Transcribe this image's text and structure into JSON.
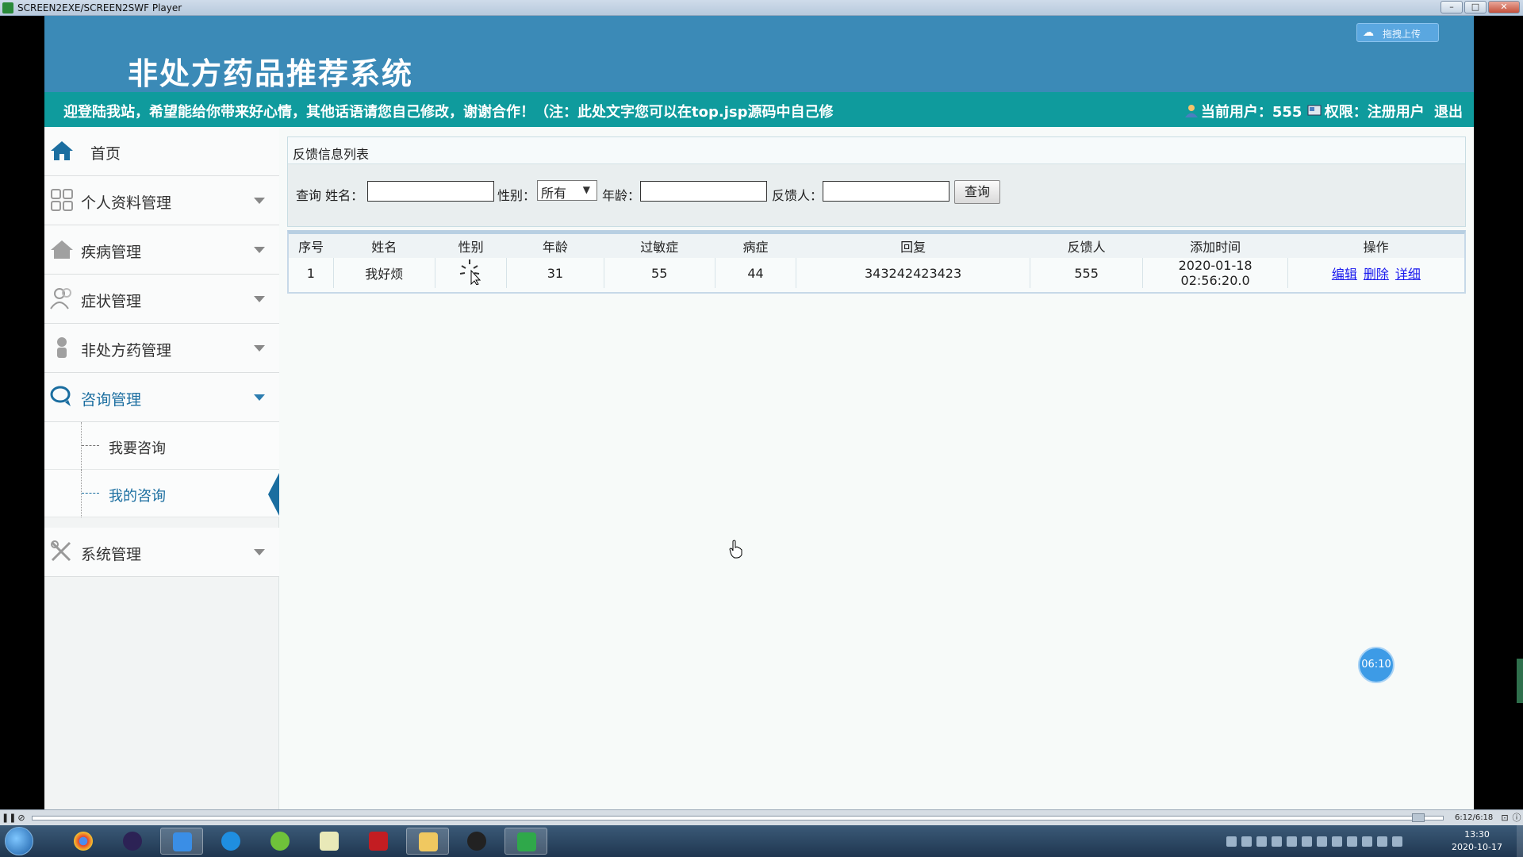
{
  "window": {
    "title": "SCREEN2EXE/SCREEN2SWF Player",
    "buttons": [
      "–",
      "□",
      "✕"
    ]
  },
  "header": {
    "system_title": "非处方药品推荐系统",
    "upload_label": "拖拽上传",
    "upload_icon": "baidu-cloud-icon"
  },
  "notice": {
    "marquee": "迎登陆我站，希望能给你带来好心情，其他话语请您自己修改，谢谢合作！（注：此处文字您可以在top.jsp源码中自己修",
    "current_user_label": "当前用户：",
    "current_user": "555",
    "role_label": "权限：",
    "role": "注册用户",
    "logout": "退出"
  },
  "sidebar": {
    "home": "首页",
    "items": [
      {
        "label": "个人资料管理",
        "icon": "grid-icon"
      },
      {
        "label": "疾病管理",
        "icon": "house-icon"
      },
      {
        "label": "症状管理",
        "icon": "users-icon"
      },
      {
        "label": "非处方药管理",
        "icon": "person-icon"
      },
      {
        "label": "咨询管理",
        "icon": "chat-icon",
        "active": true
      },
      {
        "label": "系统管理",
        "icon": "tools-icon"
      }
    ],
    "submenu": [
      {
        "label": "我要咨询"
      },
      {
        "label": "我的咨询",
        "current": true
      }
    ]
  },
  "panel": {
    "title": "反馈信息列表",
    "query_label": "查询 姓名：",
    "gender_label": "性别：",
    "gender_selected": "所有",
    "age_label": "年龄：",
    "feedback_person_label": "反馈人：",
    "query_button": "查询",
    "name_value": "",
    "age_value": "",
    "person_value": ""
  },
  "table": {
    "columns": [
      "序号",
      "姓名",
      "性别",
      "年龄",
      "过敏症",
      "病症",
      "回复",
      "反馈人",
      "添加时间",
      "操作"
    ],
    "rows": [
      {
        "index": "1",
        "name": "我好烦",
        "gender": "",
        "age": "31",
        "allergy": "55",
        "disease": "44",
        "reply": "343242423423",
        "person": "555",
        "time": "2020-01-18 02:56:20.0",
        "ops": [
          "编辑",
          "删除",
          "详细"
        ]
      }
    ]
  },
  "overlay": {
    "timer": "06:10"
  },
  "player": {
    "time": "6:12/6:18"
  },
  "taskbar": {
    "apps": [
      "chrome-icon",
      "eclipse-icon",
      "baidu-cloud-icon",
      "qq-browser-icon",
      "360-icon",
      "notepad-icon",
      "flash-icon",
      "explorer-icon",
      "qq-icon",
      "screen2exe-icon"
    ],
    "clock_time": "13:30",
    "clock_date": "2020-10-17"
  },
  "colors": {
    "header_blue": "#3b8ab7",
    "notice_teal": "#0f9b9d",
    "link_blue": "#1a1aee",
    "accent": "#1b6ea0"
  }
}
